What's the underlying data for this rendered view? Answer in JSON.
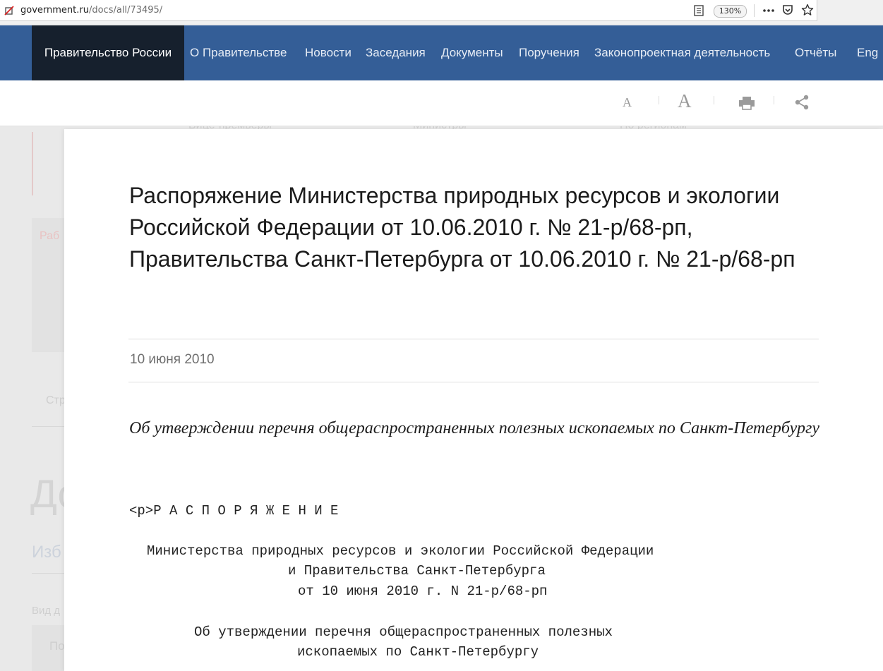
{
  "browser": {
    "url_host": "government.ru",
    "url_path": "/docs/all/73495/",
    "zoom": "130%"
  },
  "nav": {
    "home": "Правительство России",
    "items": [
      "О Правительстве",
      "Новости",
      "Заседания",
      "Документы",
      "Поручения",
      "Законопроектная деятельность",
      "Отчёты",
      "Eng"
    ]
  },
  "toolbar": {
    "font_small": "A",
    "font_large": "A"
  },
  "background": {
    "links": [
      "Вице-премьеры",
      "Министры",
      "По регионам"
    ],
    "fragments": [
      "Раб",
      "Стр",
      "До",
      "Изб",
      "Вид д",
      "По"
    ]
  },
  "document": {
    "title": "Распоряжение Министерства природных ресурсов и экологии Российской Федерации от 10.06.2010 г. № 21-р/68-рп, Правительства Санкт-Петербурга от 10.06.2010 г. № 21-р/68-рп",
    "date": "10 июня 2010",
    "subtitle": "Об утверждении перечня общераспространенных полезных ископаемых по Санкт-Петербургу",
    "body_lines": [
      "<p>Р А С П О Р Я Ж Е Н И Е",
      "Министерства природных ресурсов и экологии Российской Федерации",
      "и Правительства Санкт-Петербурга",
      "от 10 июня 2010 г. N 21-р/68-рп",
      "Об утверждении перечня общераспространенных полезных",
      "ископаемых по Санкт-Петербургу"
    ]
  },
  "colors": {
    "nav_bg": "#345e97",
    "nav_home_bg": "#16202d"
  }
}
